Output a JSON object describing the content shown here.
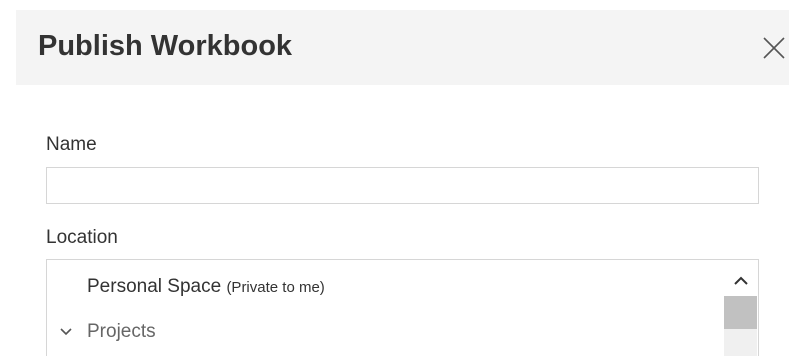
{
  "dialog": {
    "title": "Publish Workbook",
    "close_icon": "close-icon"
  },
  "form": {
    "name_label": "Name",
    "name_value": "",
    "location_label": "Location",
    "locations": {
      "personal_space": "Personal Space",
      "personal_space_note": "(Private to me)",
      "projects": "Projects"
    }
  },
  "icons": {
    "projects_expander": "chevron-down-icon",
    "scroll_up": "chevron-up-icon"
  },
  "colors": {
    "header_bg": "#f4f4f4",
    "border": "#d6d6d6",
    "scroll_thumb": "#c1c1c1"
  }
}
